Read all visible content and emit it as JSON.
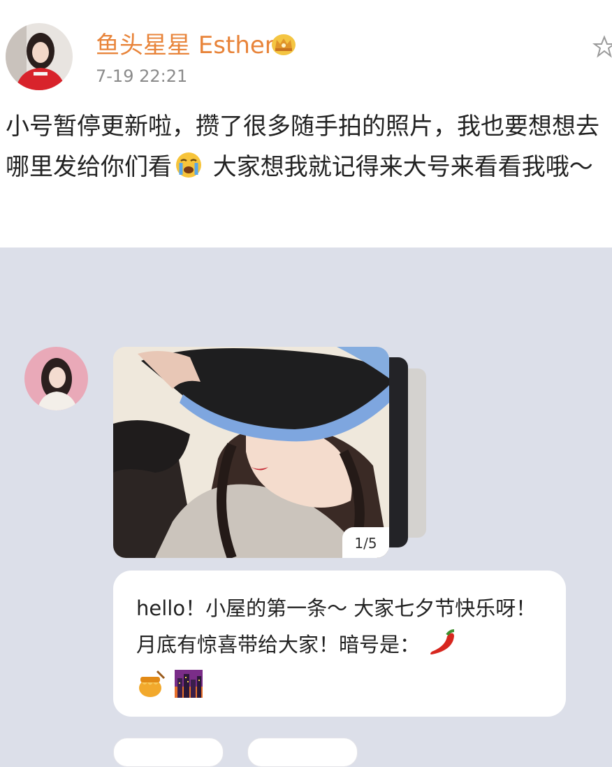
{
  "post": {
    "username": "鱼头星星 Esther",
    "timestamp": "7-19 22:21",
    "text_part1": "小号暂停更新啦，攒了很多随手拍的照片，我也要想想去哪里发给你们看",
    "text_part2": " 大家想我就记得来大号来看看我哦～",
    "icons": [
      "avatar",
      "crown-icon",
      "star-icon",
      "crying-emoji-icon"
    ]
  },
  "message": {
    "image_counter": "1/5",
    "text": "hello！小屋的第一条～ 大家七夕节快乐呀！月底有惊喜带给大家！暗号是：",
    "icons": [
      "chili-pepper-emoji-icon",
      "honey-pot-emoji-icon",
      "city-night-emoji-icon"
    ]
  },
  "colors": {
    "username": "#e8843a",
    "timestamp": "#8a8a8a",
    "page_background": "#dcdfe9",
    "bubble_background": "#ffffff"
  }
}
